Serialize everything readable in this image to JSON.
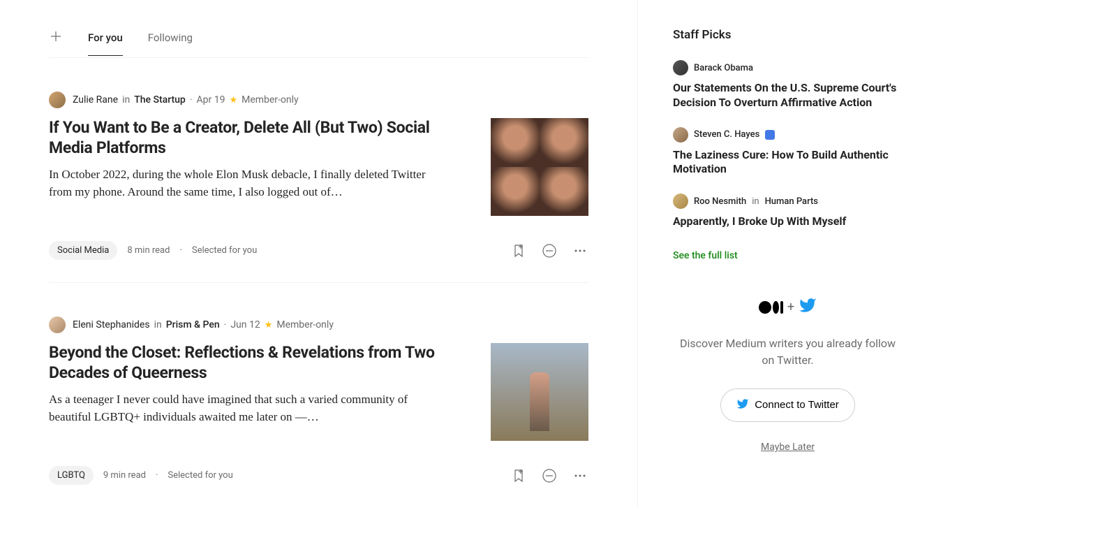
{
  "tabs": {
    "for_you": "For you",
    "following": "Following"
  },
  "articles": [
    {
      "author": "Zulie Rane",
      "in": "in",
      "publication": "The Startup",
      "date": "Apr 19",
      "member_only": "Member-only",
      "title": "If You Want to Be a Creator, Delete All (But Two) Social Media Platforms",
      "excerpt": "In October 2022, during the whole Elon Musk debacle, I finally deleted Twitter from my phone. Around the same time, I also logged out of…",
      "tag": "Social Media",
      "read_time": "8 min read",
      "selected": "Selected for you"
    },
    {
      "author": "Eleni Stephanides",
      "in": "in",
      "publication": "Prism & Pen",
      "date": "Jun 12",
      "member_only": "Member-only",
      "title": "Beyond the Closet: Reflections & Revelations from Two Decades of Queerness",
      "excerpt": "As a teenager I never could have imagined that such a varied community of beautiful LGBTQ+ individuals awaited me later on —…",
      "tag": "LGBTQ",
      "read_time": "9 min read",
      "selected": "Selected for you"
    }
  ],
  "sidebar": {
    "title": "Staff Picks",
    "picks": [
      {
        "author": "Barack Obama",
        "title": "Our Statements On the U.S. Supreme Court's Decision To Overturn Affirmative Action"
      },
      {
        "author": "Steven C. Hayes",
        "title": "The Laziness Cure: How To Build Authentic Motivation"
      },
      {
        "author": "Roo Nesmith",
        "in": "in",
        "publication": "Human Parts",
        "title": "Apparently, I Broke Up With Myself"
      }
    ],
    "full_list": "See the full list",
    "twitter": {
      "text": "Discover Medium writers you already follow on Twitter.",
      "connect": "Connect to Twitter",
      "maybe_later": "Maybe Later"
    }
  }
}
